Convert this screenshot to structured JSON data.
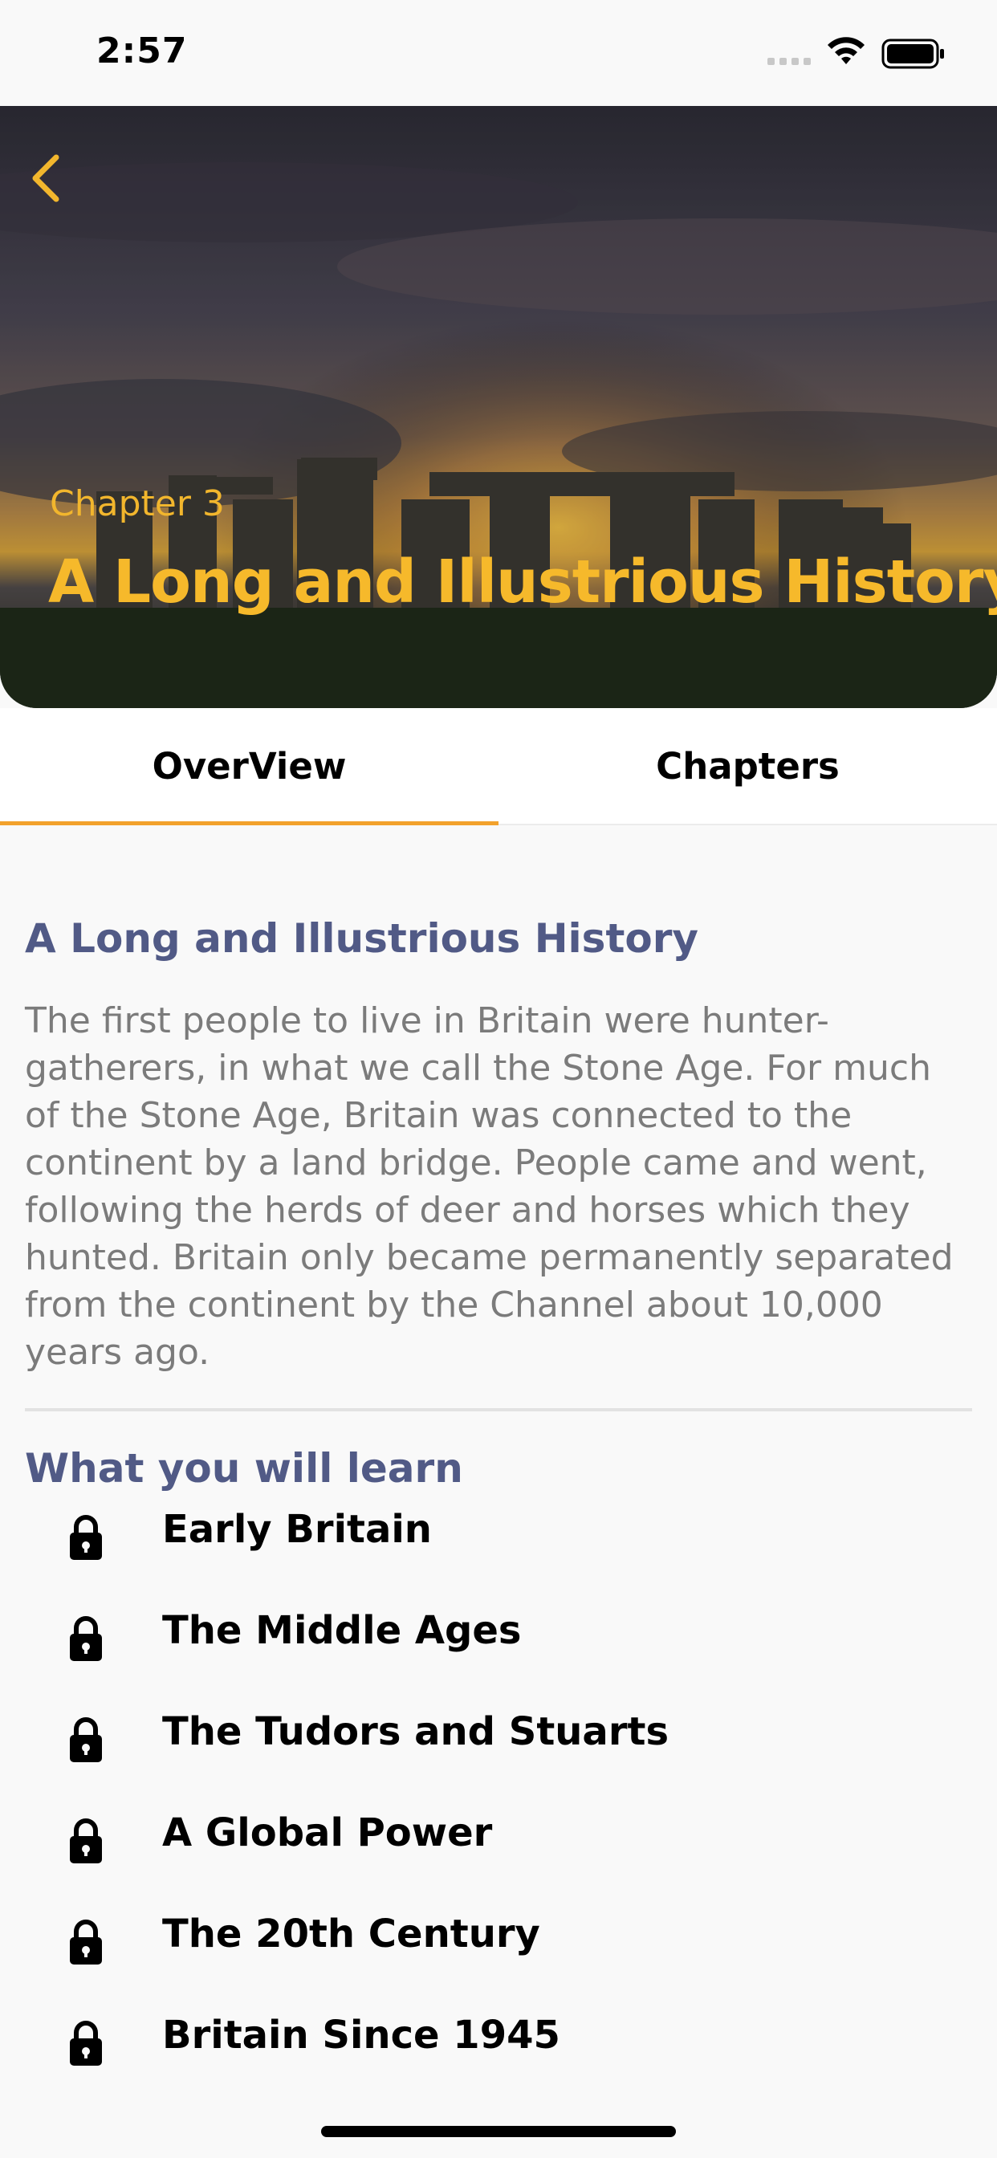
{
  "status_bar": {
    "time": "2:57"
  },
  "hero": {
    "chapter_label": "Chapter 3",
    "title": "A Long and Illustrious History",
    "accent_color": "#f6b92b"
  },
  "tabs": [
    {
      "label": "OverView",
      "selected": true
    },
    {
      "label": "Chapters",
      "selected": false
    }
  ],
  "overview": {
    "title": "A Long and Illustrious History",
    "body": "The first people to live in Britain were hunter-gatherers, in what we call the Stone Age. For much of the Stone Age, Britain was connected to the continent by a land bridge. People came and went, following the herds of deer and horses which they hunted. Britain only became permanently separated from the continent by the Channel about 10,000 years ago."
  },
  "learn": {
    "title": "What you will learn",
    "items": [
      {
        "label": "Early Britain",
        "icon": "lock-icon"
      },
      {
        "label": "The Middle Ages",
        "icon": "lock-icon"
      },
      {
        "label": "The Tudors and Stuarts",
        "icon": "lock-icon"
      },
      {
        "label": "A Global Power",
        "icon": "lock-icon"
      },
      {
        "label": "The 20th Century",
        "icon": "lock-icon"
      },
      {
        "label": "Britain Since 1945",
        "icon": "lock-icon"
      }
    ]
  },
  "colors": {
    "tab_indicator": "#f2a22c",
    "section_title": "#515a86",
    "body_text": "#7b7b7b"
  }
}
